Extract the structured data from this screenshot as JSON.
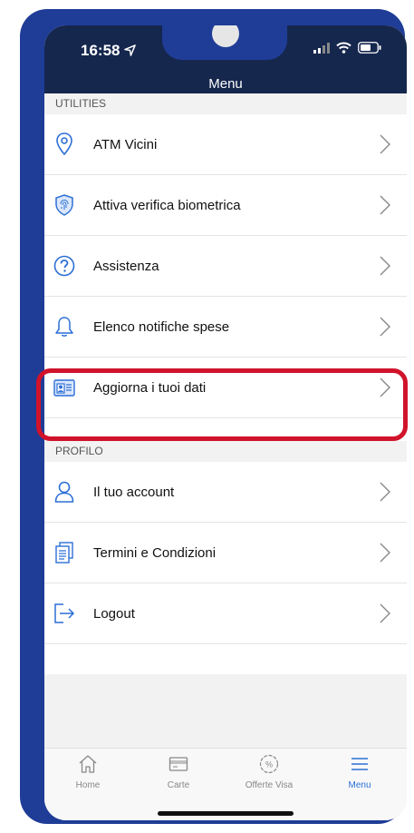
{
  "status": {
    "time": "16:58"
  },
  "header": {
    "title": "Menu"
  },
  "sections": [
    {
      "title": "UTILITIES",
      "items": [
        {
          "label": "ATM Vicini",
          "icon": "location-pin-icon"
        },
        {
          "label": "Attiva verifica biometrica",
          "icon": "fingerprint-shield-icon"
        },
        {
          "label": "Assistenza",
          "icon": "help-icon"
        },
        {
          "label": "Elenco notifiche spese",
          "icon": "bell-icon"
        },
        {
          "label": "Aggiorna i tuoi dati",
          "icon": "id-card-icon"
        }
      ]
    },
    {
      "title": "PROFILO",
      "items": [
        {
          "label": "Il tuo account",
          "icon": "user-icon"
        },
        {
          "label": "Termini e Condizioni",
          "icon": "document-icon"
        },
        {
          "label": "Logout",
          "icon": "logout-icon"
        }
      ]
    }
  ],
  "tabbar": [
    {
      "label": "Home",
      "icon": "home-icon"
    },
    {
      "label": "Carte",
      "icon": "card-icon"
    },
    {
      "label": "Offerte Visa",
      "icon": "percent-icon"
    },
    {
      "label": "Menu",
      "icon": "menu-icon",
      "active": true
    }
  ],
  "colors": {
    "accent": "#2c6fd6",
    "header": "#16274e",
    "frame": "#1f3d97",
    "highlight": "#d0132b"
  }
}
